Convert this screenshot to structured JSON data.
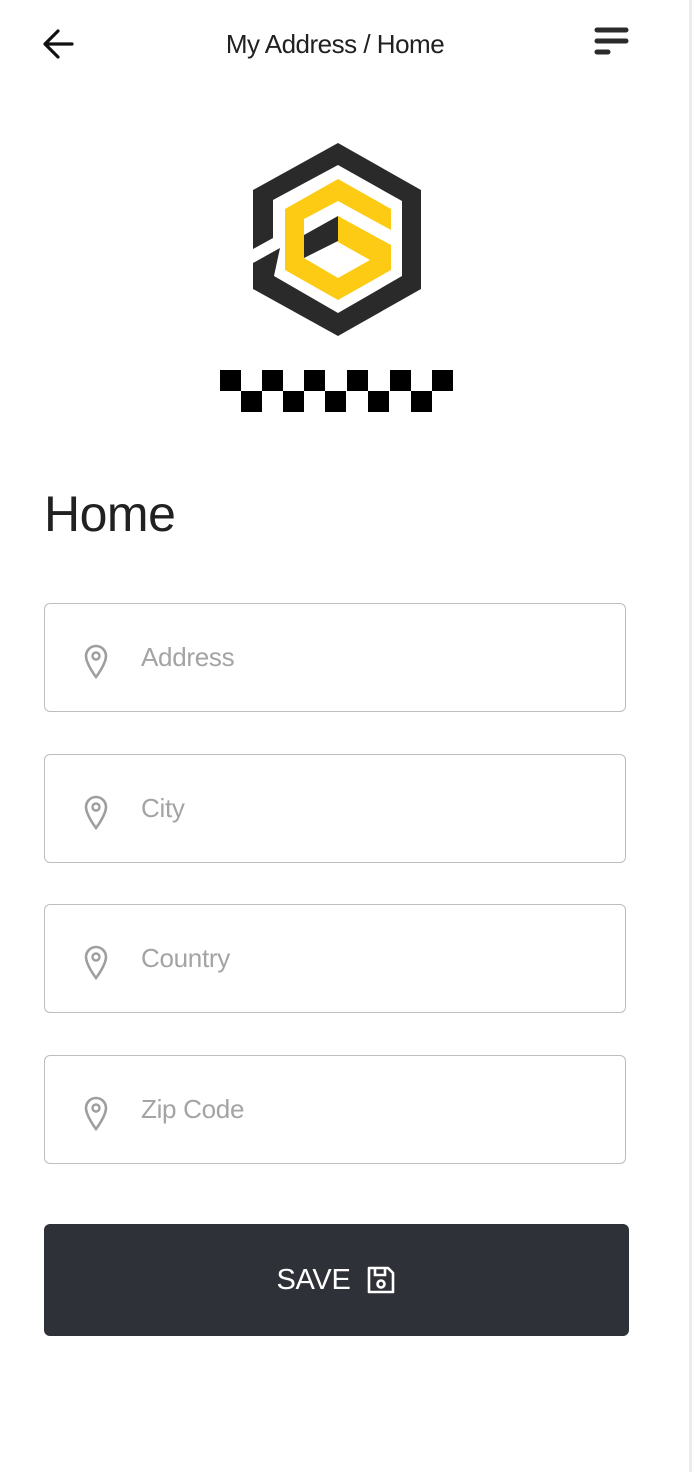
{
  "header": {
    "title": "My Address / Home",
    "back_icon": "arrow-left-icon",
    "menu_icon": "menu-lines-icon"
  },
  "logo": {
    "colors": {
      "dark": "#2a2a2a",
      "accent": "#fdcb14",
      "checker": "#000000"
    }
  },
  "form": {
    "heading": "Home",
    "fields": [
      {
        "placeholder": "Address",
        "value": "",
        "icon": "map-pin-icon"
      },
      {
        "placeholder": "City",
        "value": "",
        "icon": "map-pin-icon"
      },
      {
        "placeholder": "Country",
        "value": "",
        "icon": "map-pin-icon"
      },
      {
        "placeholder": "Zip Code",
        "value": "",
        "icon": "map-pin-icon"
      }
    ],
    "save_label": "SAVE",
    "save_icon": "floppy-disk-icon",
    "button_color": "#2e3138"
  }
}
